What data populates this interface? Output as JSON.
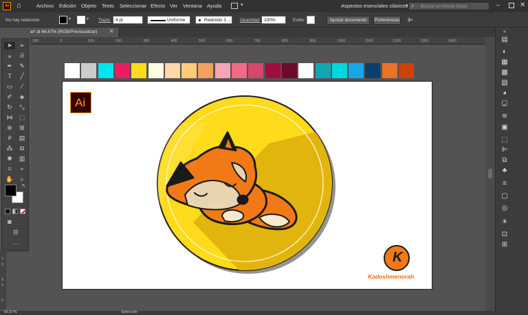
{
  "menu": {
    "items": [
      "Archivo",
      "Edición",
      "Objeto",
      "Texto",
      "Seleccionar",
      "Efecto",
      "Ver",
      "Ventana",
      "Ayuda"
    ],
    "workspace": "Aspectos esenciales clásicos",
    "stock_search_placeholder": "Buscar en Adobe Stock"
  },
  "control": {
    "selection": "No hay selección",
    "stroke_label": "Trazo:",
    "stroke_weight": "4 pt",
    "profile": "Uniforme",
    "brush": "Redondo 3 ...",
    "opacity_label": "Opacidad:",
    "opacity_value": "100%",
    "style_label": "Estilo:",
    "doc_setup_button": "Ajustar documento",
    "prefs_button": "Preferencias"
  },
  "document": {
    "tab_title": "ai* al 66,67% (RGB/Previsualizar)"
  },
  "ruler": {
    "top_ticks": [
      "100",
      "0",
      "100",
      "200",
      "300",
      "400",
      "500",
      "600",
      "700",
      "800",
      "900",
      "1000",
      "1100",
      "1200",
      "1300",
      "1400"
    ],
    "left_ticks": [
      "7",
      "0",
      "8",
      "0",
      "0"
    ]
  },
  "status": {
    "zoom": "66,67%",
    "mode": "Selección"
  },
  "artboard": {
    "ai_logo_text": "Ai",
    "signature_letter": "K",
    "signature_name": "Kadoshmenorah"
  },
  "swatches": [
    "#ffffff",
    "#cccccc",
    "#00e5ee",
    "#ee1c63",
    "#fedc1c",
    "#fffde0",
    "#fed9a8",
    "#fecb7c",
    "#f0a35e",
    "#f7a5b5",
    "#f06a85",
    "#d8476a",
    "#a00d3e",
    "#6e0b28",
    "#ffffff",
    "#12a7b4",
    "#00d8e0",
    "#12a9e8",
    "#0c3f6c",
    "#ef7126",
    "#d14105"
  ],
  "colors": {
    "app_bg": "#535353",
    "panel": "#3c3c3c",
    "circle_yellow": "#fedb1b",
    "fox_orange": "#f27a16"
  }
}
